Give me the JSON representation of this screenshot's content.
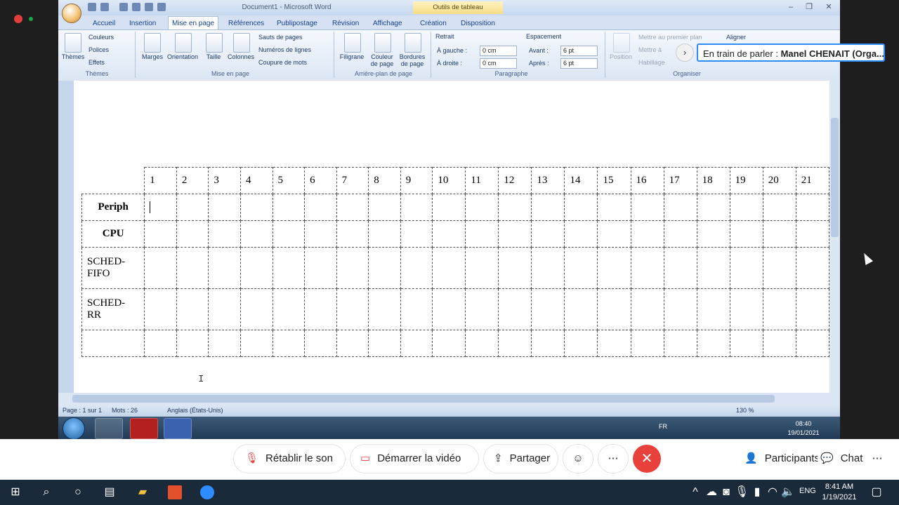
{
  "window": {
    "title": "Document1 - Microsoft Word",
    "context_tab": "Outils de tableau",
    "buttons": [
      "–",
      "❐",
      "✕"
    ]
  },
  "tabs": [
    "Accueil",
    "Insertion",
    "Mise en page",
    "Références",
    "Publipostage",
    "Révision",
    "Affichage",
    "Création",
    "Disposition"
  ],
  "active_tab": "Mise en page",
  "ribbon": {
    "themes": {
      "big": "Thèmes",
      "couleurs": "Couleurs",
      "polices": "Polices",
      "effets": "Effets",
      "group": "Thèmes"
    },
    "mise_en_page": {
      "marges": "Marges",
      "orientation": "Orientation",
      "taille": "Taille",
      "colonnes": "Colonnes",
      "sauts": "Sauts de pages",
      "numeros": "Numéros de lignes",
      "coupure": "Coupure de mots",
      "group": "Mise en page"
    },
    "arriere_plan": {
      "filigrane": "Filigrane",
      "couleur": "Couleur de page",
      "bordures": "Bordures de page",
      "group": "Arrière-plan de page"
    },
    "paragraphe": {
      "retrait": "Retrait",
      "gauche": "À gauche :",
      "droite": "À droite :",
      "gauche_val": "0 cm",
      "droite_val": "0 cm",
      "espacement": "Espacement",
      "avant": "Avant :",
      "apres": "Après :",
      "avant_val": "6 pt",
      "apres_val": "6 pt",
      "group": "Paragraphe"
    },
    "organiser": {
      "position": "Position",
      "premier_plan": "Mettre au premier plan",
      "arriere": "Mettre à",
      "habillage": "Habillage",
      "aligner": "Aligner",
      "group": "Organiser"
    }
  },
  "speaking": {
    "prefix": "En train de parler :",
    "name": "Manel CHENAIT (Orga..."
  },
  "table": {
    "headers": [
      "1",
      "2",
      "3",
      "4",
      "5",
      "6",
      "7",
      "8",
      "9",
      "10",
      "11",
      "12",
      "13",
      "14",
      "15",
      "16",
      "17",
      "18",
      "19",
      "20",
      "21"
    ],
    "rows": [
      {
        "label": "Periph",
        "bold": true
      },
      {
        "label": "CPU",
        "bold": true
      },
      {
        "label": "SCHED-FIFO",
        "line1": "SCHED-",
        "line2": "FIFO",
        "bold": false
      },
      {
        "label": "SCHED-RR",
        "line1": "SCHED-",
        "line2": "RR",
        "bold": false
      },
      {
        "label": "",
        "bold": false
      }
    ]
  },
  "statusbar": {
    "page": "Page : 1 sur 1",
    "words": "Mots : 26",
    "language": "Anglais (États-Unis)",
    "zoom": "130 %"
  },
  "win7": {
    "lang": "FR",
    "time": "08:40",
    "date": "19/01/2021"
  },
  "zoom_controls": {
    "unmute": "Rétablir le son",
    "video": "Démarrer la vidéo",
    "share": "Partager",
    "participants": "Participants",
    "chat": "Chat"
  },
  "win10": {
    "lang": "ENG",
    "time": "8:41 AM",
    "date": "1/19/2021"
  }
}
